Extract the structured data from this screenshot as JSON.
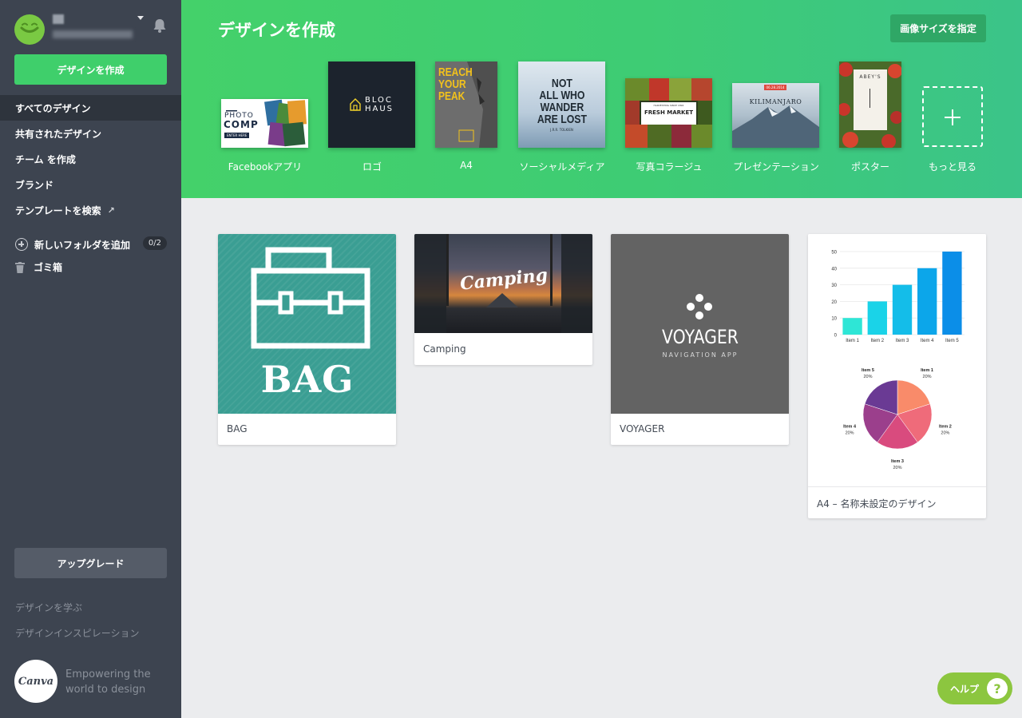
{
  "sidebar": {
    "create_button": "デザインを作成",
    "nav": [
      {
        "label": "すべてのデザイン",
        "active": true
      },
      {
        "label": "共有されたデザイン"
      },
      {
        "label": "チーム を作成"
      },
      {
        "label": "ブランド"
      },
      {
        "label": "テンプレートを検索"
      }
    ],
    "folder": {
      "label": "新しいフォルダを追加",
      "count": "0/2"
    },
    "trash": "ゴミ箱",
    "upgrade_button": "アップグレード",
    "footer_links": [
      "デザインを学ぶ",
      "デザインインスピレーション"
    ],
    "logo_text": "Canva",
    "tagline": "Empowering the world to design"
  },
  "header": {
    "title": "デザインを作成",
    "custom_size_button": "画像サイズを指定",
    "templates": [
      {
        "label": "Facebookアプリ",
        "thumb_text": [
          "PHOTO",
          "COMP"
        ],
        "thumb_small": "ENTER HERE"
      },
      {
        "label": "ロゴ",
        "thumb_text": [
          "BLOC",
          "HAUS"
        ]
      },
      {
        "label": "A4",
        "thumb_text": [
          "REACH",
          "YOUR",
          "PEAK"
        ]
      },
      {
        "label": "ソーシャルメディア",
        "thumb_text": [
          "NOT",
          "ALL WHO",
          "WANDER",
          "ARE LOST"
        ],
        "thumb_small": "J.R.R. TOLKIEN"
      },
      {
        "label": "写真コラージュ",
        "thumb_text": [
          "FRESH MARKET"
        ],
        "thumb_small": "HARVESTING SINCE 1892"
      },
      {
        "label": "プレゼンテーション",
        "thumb_text": [
          "KILIMANJARO"
        ],
        "thumb_small": "06.28.2014"
      },
      {
        "label": "ポスター",
        "thumb_text": [
          "ABEY'S"
        ]
      },
      {
        "label": "もっと見る"
      }
    ]
  },
  "designs": [
    {
      "caption": "BAG",
      "art_text": "BAG"
    },
    {
      "caption": "Camping",
      "art_text": "Camping"
    },
    {
      "caption": "VOYAGER",
      "art_text": "VOYAGER",
      "art_sub": "NAVIGATION APP"
    },
    {
      "caption": "A4 – 名称未設定のデザイン"
    }
  ],
  "chart_data": [
    {
      "type": "bar",
      "categories": [
        "Item 1",
        "Item 2",
        "Item 3",
        "Item 4",
        "Item 5"
      ],
      "values": [
        10,
        20,
        30,
        40,
        50
      ],
      "ylim": [
        0,
        50
      ],
      "yticks": [
        0,
        10,
        20,
        30,
        40,
        50
      ],
      "grid": true,
      "colors": [
        "#2ee6d6",
        "#1ad3e8",
        "#14bde9",
        "#0ca6ea",
        "#0b8ee8"
      ]
    },
    {
      "type": "pie",
      "labels": [
        "Item 1",
        "Item 2",
        "Item 3",
        "Item 4",
        "Item 5"
      ],
      "values": [
        20,
        20,
        20,
        20,
        20
      ],
      "value_labels": [
        "20%",
        "20%",
        "20%",
        "20%",
        "20%"
      ],
      "colors": [
        "#f98b6a",
        "#ef6b7a",
        "#d94b7e",
        "#9b3f8c",
        "#6a3a94"
      ]
    }
  ],
  "help": {
    "label": "ヘルプ",
    "icon_text": "?"
  },
  "colors": {
    "sidebar": "#3d4450",
    "header_green": "#3fcf6b",
    "help": "#8cc63f"
  }
}
